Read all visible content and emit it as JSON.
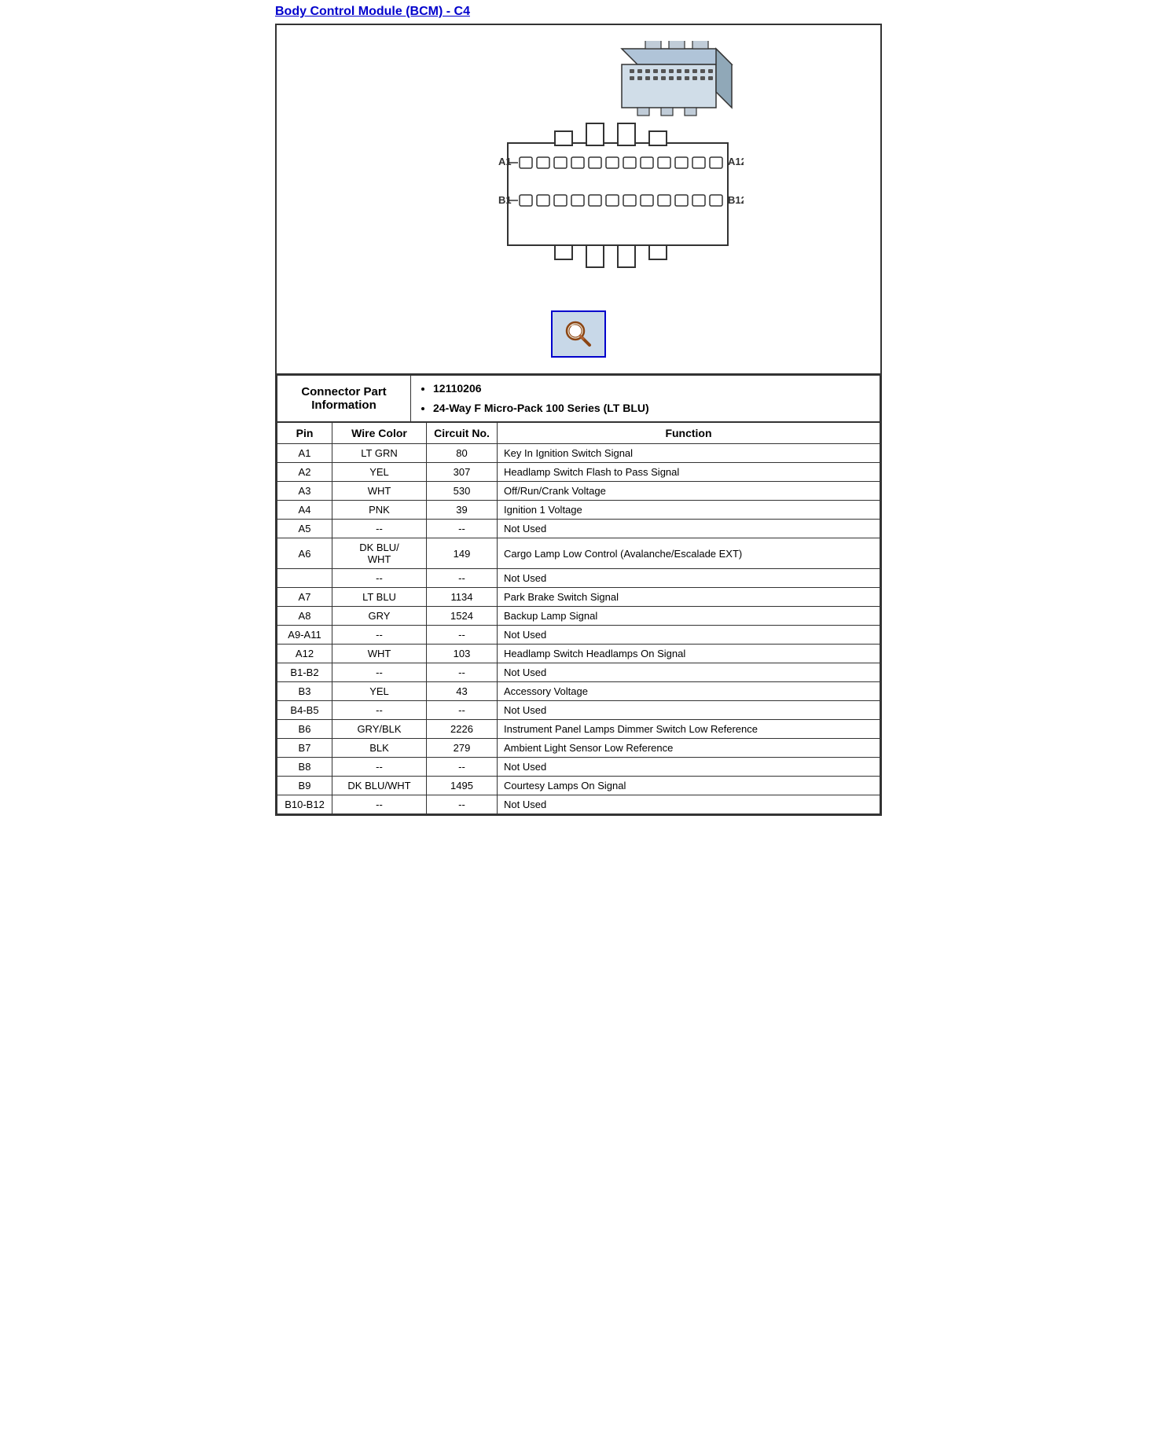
{
  "title": "Body Control Module (BCM) - C4",
  "connector_info": {
    "label": "Connector Part Information",
    "items": [
      "12110206",
      "24-Way F Micro-Pack 100 Series (LT BLU)"
    ]
  },
  "table_headers": {
    "pin": "Pin",
    "wire_color": "Wire Color",
    "circuit_no": "Circuit No.",
    "function": "Function"
  },
  "rows": [
    {
      "pin": "A1",
      "wire": "LT GRN",
      "circuit": "80",
      "function": "Key In Ignition Switch Signal"
    },
    {
      "pin": "A2",
      "wire": "YEL",
      "circuit": "307",
      "function": "Headlamp Switch Flash to Pass Signal"
    },
    {
      "pin": "A3",
      "wire": "WHT",
      "circuit": "530",
      "function": "Off/Run/Crank Voltage"
    },
    {
      "pin": "A4",
      "wire": "PNK",
      "circuit": "39",
      "function": "Ignition 1 Voltage"
    },
    {
      "pin": "A5",
      "wire": "--",
      "circuit": "--",
      "function": "Not Used"
    },
    {
      "pin": "A6",
      "wire": "DK BLU/\nWHT",
      "circuit": "149",
      "function": "Cargo Lamp Low Control (Avalanche/Escalade EXT)"
    },
    {
      "pin": "",
      "wire": "--",
      "circuit": "--",
      "function": "Not Used"
    },
    {
      "pin": "A7",
      "wire": "LT BLU",
      "circuit": "1134",
      "function": "Park Brake Switch Signal"
    },
    {
      "pin": "A8",
      "wire": "GRY",
      "circuit": "1524",
      "function": "Backup Lamp Signal"
    },
    {
      "pin": "A9-A11",
      "wire": "--",
      "circuit": "--",
      "function": "Not Used"
    },
    {
      "pin": "A12",
      "wire": "WHT",
      "circuit": "103",
      "function": "Headlamp Switch Headlamps On Signal"
    },
    {
      "pin": "B1-B2",
      "wire": "--",
      "circuit": "--",
      "function": "Not Used"
    },
    {
      "pin": "B3",
      "wire": "YEL",
      "circuit": "43",
      "function": "Accessory Voltage"
    },
    {
      "pin": "B4-B5",
      "wire": "--",
      "circuit": "--",
      "function": "Not Used"
    },
    {
      "pin": "B6",
      "wire": "GRY/BLK",
      "circuit": "2226",
      "function": "Instrument Panel Lamps Dimmer Switch Low Reference"
    },
    {
      "pin": "B7",
      "wire": "BLK",
      "circuit": "279",
      "function": "Ambient Light Sensor Low Reference"
    },
    {
      "pin": "B8",
      "wire": "--",
      "circuit": "--",
      "function": "Not Used"
    },
    {
      "pin": "B9",
      "wire": "DK BLU/WHT",
      "circuit": "1495",
      "function": "Courtesy Lamps On Signal"
    },
    {
      "pin": "B10-B12",
      "wire": "--",
      "circuit": "--",
      "function": "Not Used"
    }
  ]
}
